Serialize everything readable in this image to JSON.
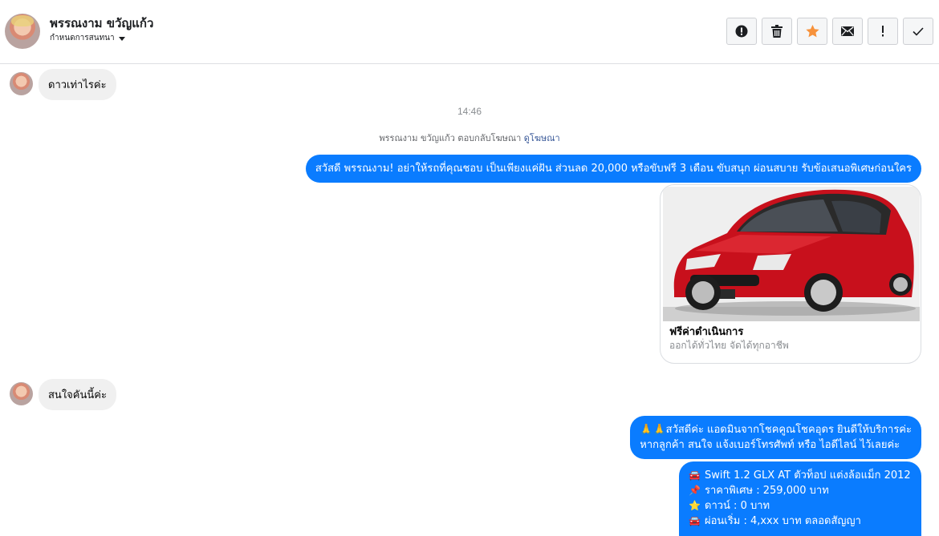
{
  "header": {
    "contact_name": "พรรณงาม ขวัญแก้ว",
    "subtitle": "กำหนดการสนทนา",
    "toolbar": [
      {
        "name": "spam-button",
        "icon": "alert-circle-icon"
      },
      {
        "name": "delete-button",
        "icon": "trash-icon"
      },
      {
        "name": "star-button",
        "icon": "star-icon"
      },
      {
        "name": "mark-unread-button",
        "icon": "envelope-icon"
      },
      {
        "name": "follow-up-button",
        "icon": "exclamation-icon"
      },
      {
        "name": "mark-done-button",
        "icon": "checkmark-icon"
      }
    ],
    "star_color": "#f7923b"
  },
  "messages": {
    "m1": "ดาวเท่าไรค่ะ",
    "timestamp": "14:46",
    "ad_reply_prefix": "พรรณงาม ขวัญแก้ว ตอบกลับโฆษณา",
    "ad_reply_link": "ดูโฆษณา",
    "m2": "สวัสดี พรรณงาม! อย่าให้รถที่คุณชอบ เป็นเพียงแค่ฝัน ส่วนลด 20,000 หรือขับฟรี 3 เดือน ขับสนุก ผ่อนสบาย รับข้อเสนอพิเศษก่อนใคร",
    "card": {
      "title": "ฟรีค่าดำเนินการ",
      "subtitle": "ออกได้ทั่วไทย จัดได้ทุกอาชีพ"
    },
    "m3": "สนใจคันนี้ค่ะ",
    "m4_line1": "🙏🙏สวัสดีค่ะ แอดมินจากโชคคูณโชคอุดร ยินดีให้บริการค่ะ",
    "m4_line2": "หากลูกค้า สนใจ แจ้งเบอร์โทรศัพท์ หรือ ไอดีไลน์  ไว้เลยค่ะ",
    "m5": [
      {
        "emoji": "🚘",
        "text": "Swift 1.2 GLX AT ตัวท็อป แต่งล้อแม็ก 2012"
      },
      {
        "emoji": "📌",
        "text": "ราคาพิเศษ : 259,000 บาท"
      },
      {
        "emoji": "⭐",
        "text": "ดาวน์ : 0 บาท"
      },
      {
        "emoji": "🚘",
        "text": "ผ่อนเริ่ม : 4,xxx บาท ตลอดสัญญา"
      }
    ]
  },
  "colors": {
    "outgoing_bubble": "#0a7cff",
    "incoming_bubble": "#f0f0f0"
  }
}
